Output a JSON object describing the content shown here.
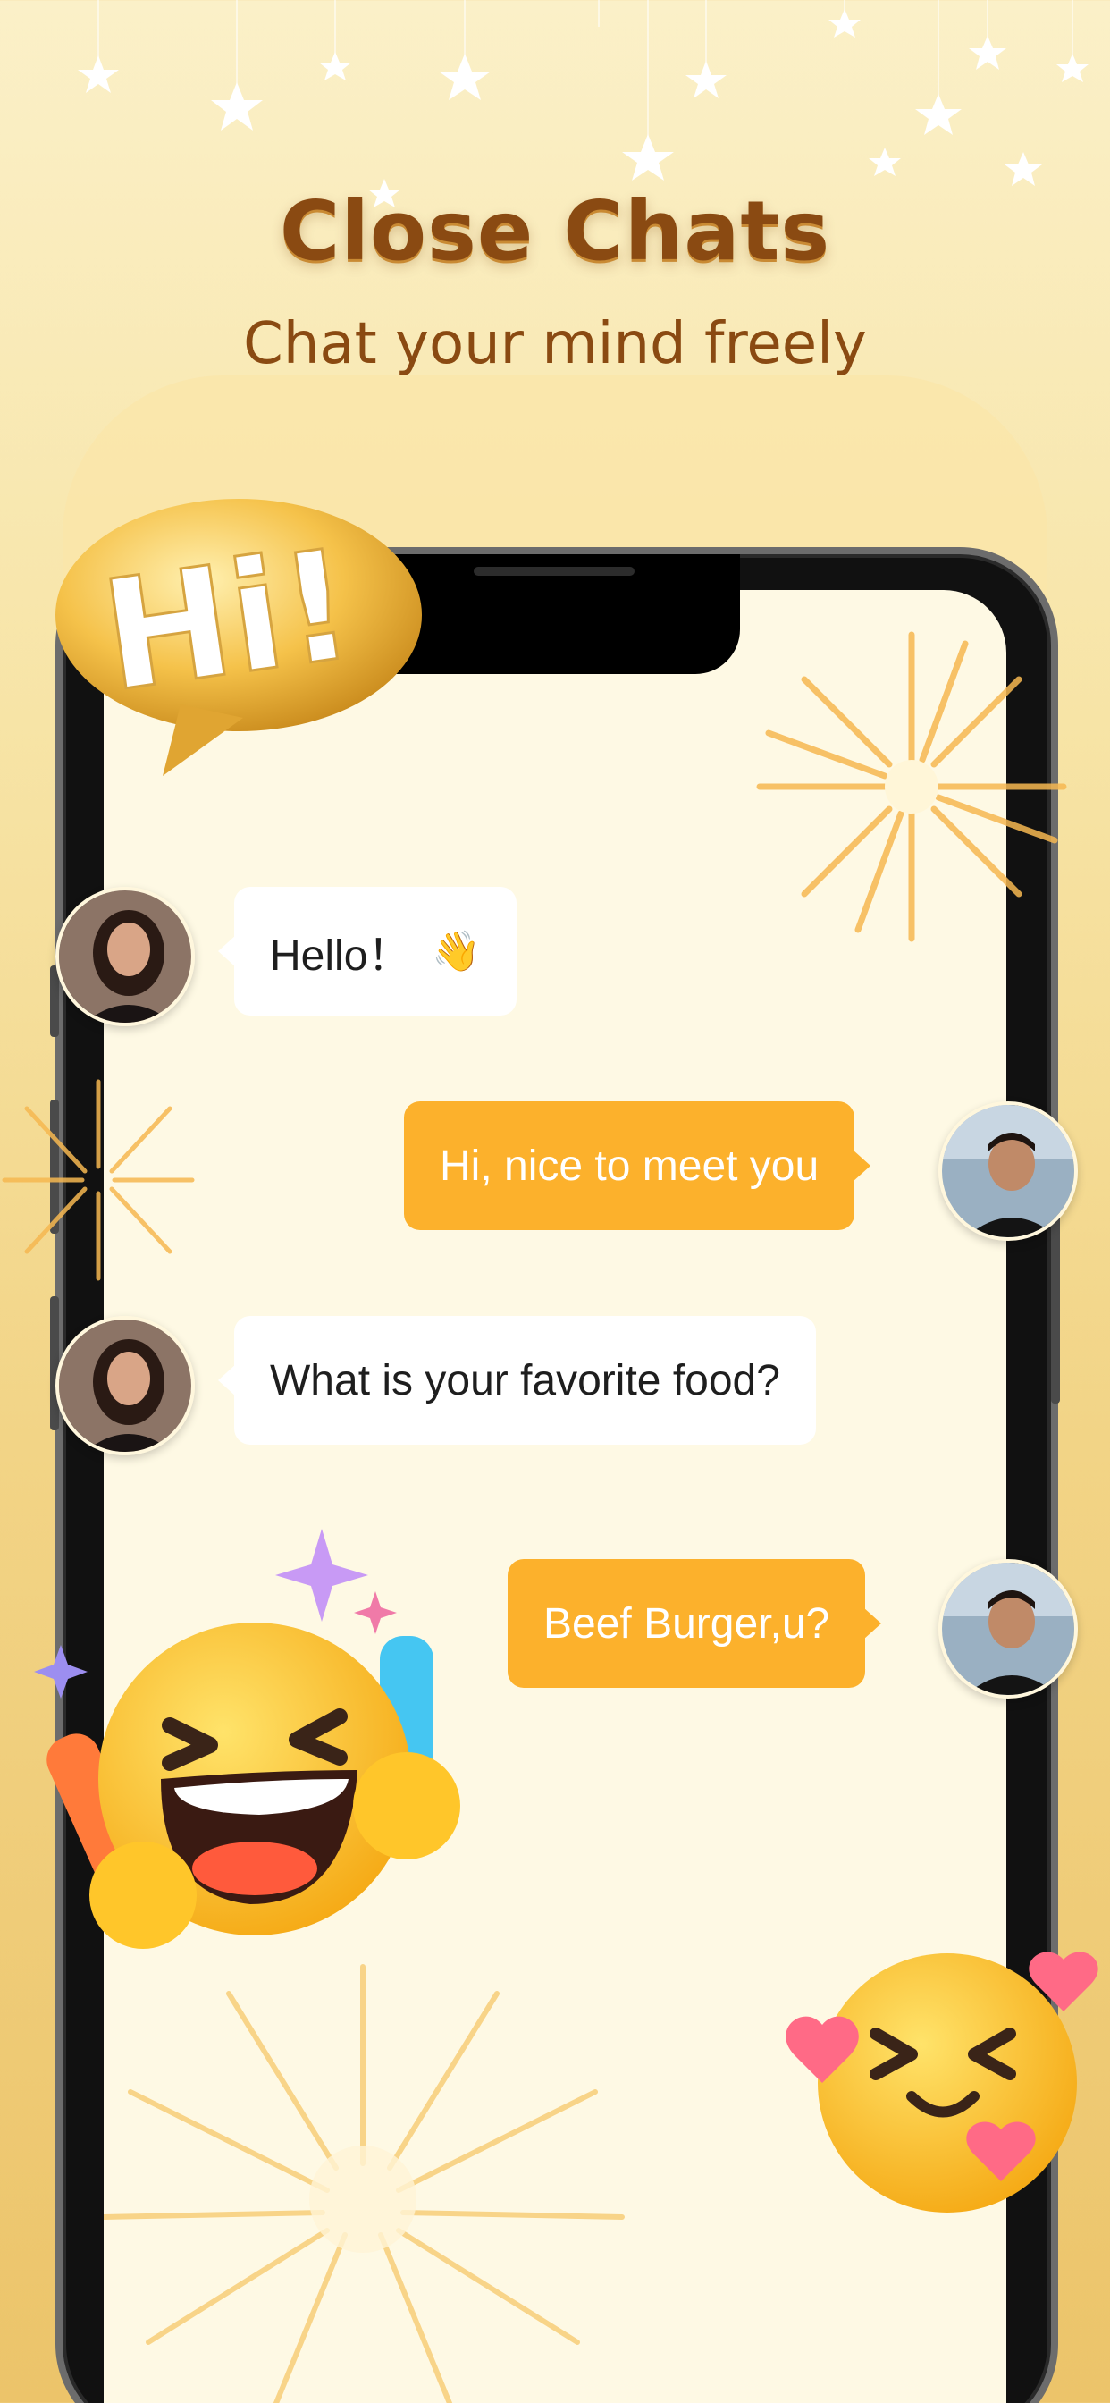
{
  "header": {
    "title": "Close Chats",
    "subtitle": "Chat your mind freely"
  },
  "badge": {
    "text": "Hi!"
  },
  "colors": {
    "title": "#8a4a12",
    "bubble_out": "#fcb12c",
    "bubble_in": "#ffffff",
    "screen": "#fef9e4"
  },
  "messages": [
    {
      "side": "in",
      "text": "Hello！",
      "emoji": "👋",
      "avatar": "woman-avatar"
    },
    {
      "side": "out",
      "text": "Hi, nice to meet you",
      "avatar": "man-avatar"
    },
    {
      "side": "in",
      "text": "What is your favorite food?",
      "avatar": "woman-avatar"
    },
    {
      "side": "out",
      "text": "Beef Burger,u?",
      "avatar": "man-avatar"
    }
  ],
  "decorations": {
    "big_emoji": "laughing-cheering-emoji",
    "small_emoji": "smiling-hearts-emoji"
  }
}
